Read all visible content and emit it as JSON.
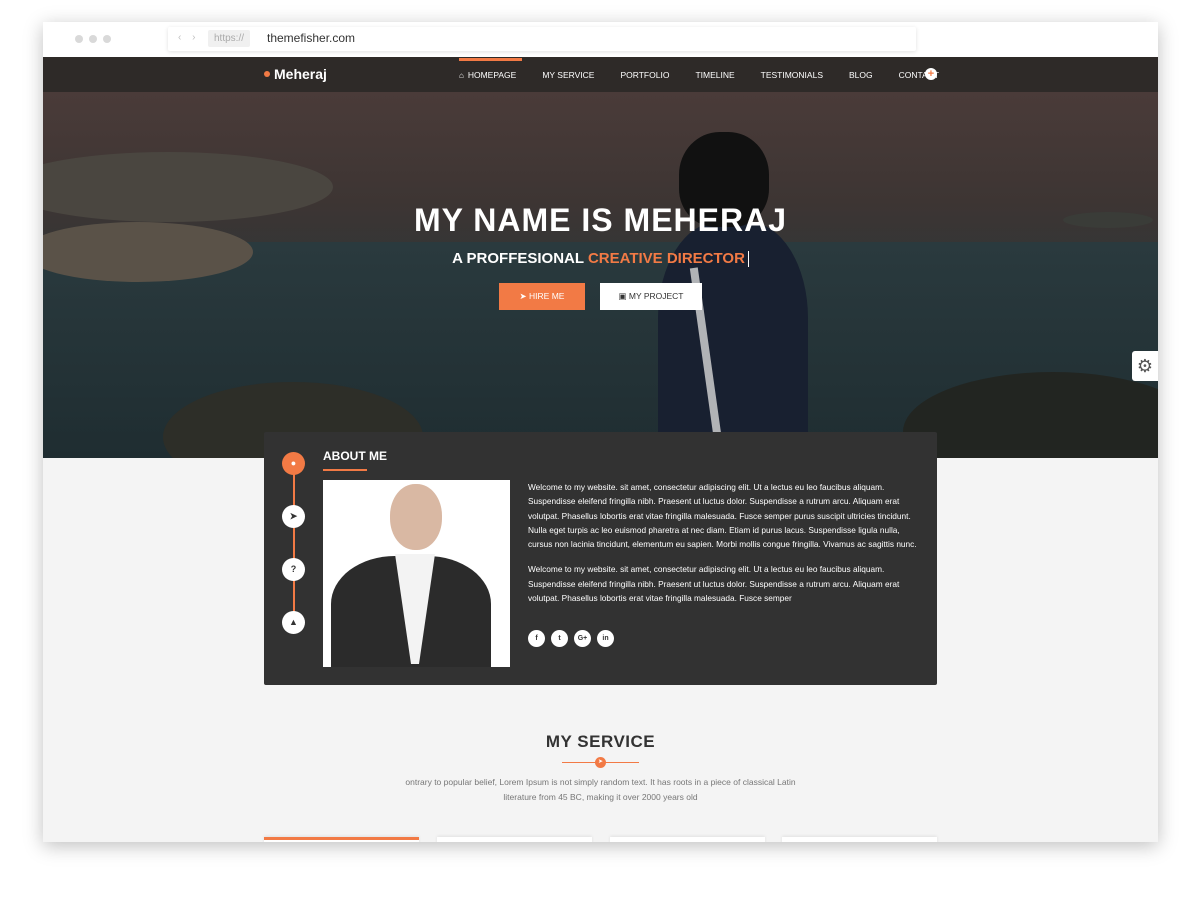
{
  "browser": {
    "protocol": "https://",
    "host": "themefisher.com"
  },
  "nav": {
    "brand": "Meheraj",
    "items": [
      {
        "label": "HOMEPAGE",
        "active": true
      },
      {
        "label": "MY SERVICE"
      },
      {
        "label": "PORTFOLIO"
      },
      {
        "label": "TIMELINE"
      },
      {
        "label": "TESTIMONIALS"
      },
      {
        "label": "BLOG"
      },
      {
        "label": "CONTACT"
      }
    ],
    "plus_icon": "+"
  },
  "hero": {
    "title": "MY NAME IS MEHERAJ",
    "subtitle_prefix": "A PROFFESIONAL",
    "subtitle_accent": "CREATIVE DIRECTOR",
    "hire_label": "HIRE ME",
    "project_label": "MY PROJECT",
    "accent_color": "#f27a45"
  },
  "about": {
    "title": "ABOUT ME",
    "timeline_icons": [
      "user-icon",
      "rocket-icon",
      "question-icon",
      "graduation-icon"
    ],
    "timeline_glyphs": [
      "●",
      "➤",
      "?",
      "▲"
    ],
    "paragraph_1": "Welcome to my website. sit amet, consectetur adipiscing elit. Ut a lectus eu leo faucibus aliquam. Suspendisse eleifend fringilla nibh. Praesent ut luctus dolor. Suspendisse a rutrum arcu. Aliquam erat volutpat. Phasellus lobortis erat vitae fringilla malesuada. Fusce semper purus suscipit ultricies tincidunt. Nulla eget turpis ac leo euismod pharetra at nec diam. Etiam id purus lacus. Suspendisse ligula nulla, cursus non lacinia tincidunt, elementum eu sapien. Morbi mollis congue fringilla. Vivamus ac sagittis nunc.",
    "paragraph_2": "Welcome to my website. sit amet, consectetur adipiscing elit. Ut a lectus eu leo faucibus aliquam. Suspendisse eleifend fringilla nibh. Praesent ut luctus dolor. Suspendisse a rutrum arcu. Aliquam erat volutpat. Phasellus lobortis erat vitae fringilla malesuada. Fusce semper",
    "socials": [
      "f",
      "t",
      "G+",
      "in"
    ]
  },
  "service": {
    "title": "MY  SERVICE",
    "description_line_1": "ontrary to popular belief, Lorem Ipsum is not simply random text. It has roots in a piece of classical Latin",
    "description_line_2": "literature from 45 BC, making it over 2000 years old"
  }
}
